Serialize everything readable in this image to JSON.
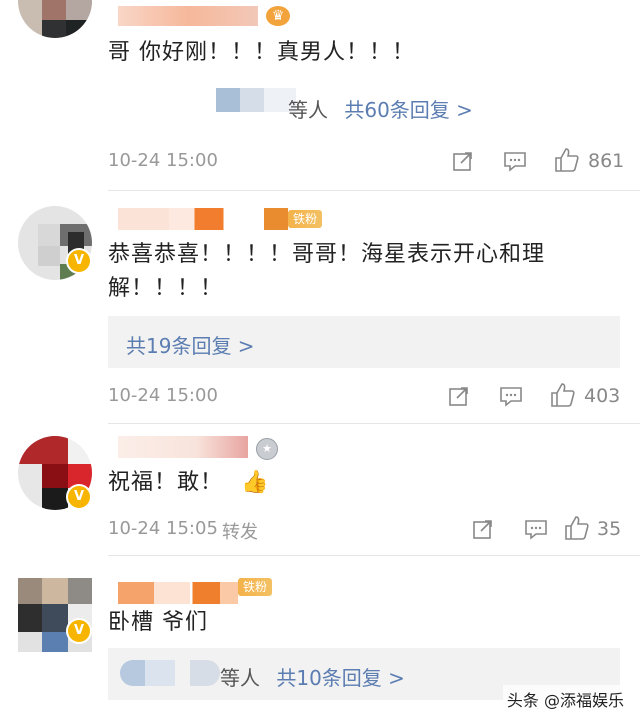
{
  "comments": [
    {
      "text": "哥 你好刚！！！真男人！！！",
      "reply_prefix": "等人",
      "reply_text": "共60条回复 >",
      "date": "10-24 15:00",
      "repost": "",
      "likes": "861"
    },
    {
      "badge": "铁粉",
      "text_line1": "恭喜恭喜！！！！哥哥！海星表示开心和理",
      "text_line2": "解！！！！",
      "reply_text": "共19条回复 >",
      "date": "10-24 15:00",
      "likes": "403"
    },
    {
      "text": "祝福！敢！",
      "emoji": "👍",
      "date": "10-24 15:05",
      "repost": "转发",
      "likes": "35"
    },
    {
      "badge": "铁粉",
      "text": "卧槽 爷们",
      "reply_prefix": "等人",
      "reply_text": "共10条回复 >"
    }
  ],
  "watermark": "头条 @添福娱乐",
  "icons": [
    "share-icon",
    "comment-icon",
    "like-icon",
    "verified-icon",
    "medal-icon",
    "crown-icon"
  ],
  "colors": {
    "link": "#5b7db1",
    "meta": "#999999",
    "reply_bg": "#f2f2f2",
    "badge": "#f4b24a"
  }
}
